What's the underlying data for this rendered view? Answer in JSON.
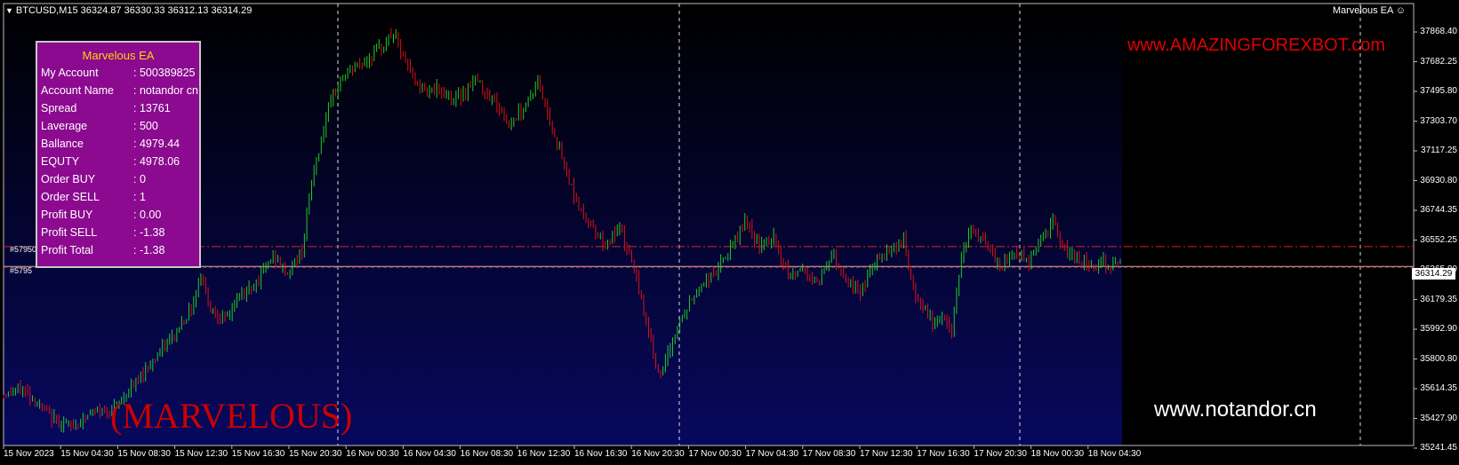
{
  "header": {
    "symbol_info": "BTCUSD,M15  36324.87 36330.33 36312.13 36314.29",
    "ea_label": "Marvelous EA ☺"
  },
  "overlay": {
    "url_top": "www.AMAZINGFOREXBOT.com",
    "url_bottom": "www.notandor.cn",
    "brand": "(MARVELOUS)",
    "order_tag_1": "#57950",
    "order_tag_2": "#5795"
  },
  "panel": {
    "title": "Marvelous EA",
    "rows": [
      {
        "label": "My Account",
        "value": ": 500389825"
      },
      {
        "label": "Account Name",
        "value": ": notandor cn"
      },
      {
        "label": "Spread",
        "value": ": 13761"
      },
      {
        "label": "Laverage",
        "value": ": 500"
      },
      {
        "label": "Ballance",
        "value": ": 4979.44"
      },
      {
        "label": "EQUTY",
        "value": ": 4978.06"
      },
      {
        "label": "Order BUY",
        "value": ": 0"
      },
      {
        "label": "Order SELL",
        "value": ": 1"
      },
      {
        "label": "Profit BUY",
        "value": ": 0.00"
      },
      {
        "label": "Profit SELL",
        "value": ": -1.38"
      },
      {
        "label": "Profit Total",
        "value": ": -1.38"
      }
    ]
  },
  "price_axis": [
    "37868.40",
    "37682.25",
    "37495.80",
    "37303.70",
    "37117.25",
    "36930.80",
    "36744.35",
    "36552.25",
    "36365.80",
    "36179.35",
    "35992.90",
    "35800.80",
    "35614.35",
    "35427.90",
    "35241.45"
  ],
  "current_price": "36314.29",
  "time_axis": [
    "15 Nov 2023",
    "15 Nov 04:30",
    "15 Nov 08:30",
    "15 Nov 12:30",
    "15 Nov 16:30",
    "15 Nov 20:30",
    "16 Nov 00:30",
    "16 Nov 04:30",
    "16 Nov 08:30",
    "16 Nov 12:30",
    "16 Nov 16:30",
    "16 Nov 20:30",
    "17 Nov 00:30",
    "17 Nov 04:30",
    "17 Nov 08:30",
    "17 Nov 12:30",
    "17 Nov 16:30",
    "17 Nov 20:30",
    "18 Nov 00:30",
    "18 Nov 04:30"
  ],
  "chart_data": {
    "type": "candlestick",
    "symbol": "BTCUSD",
    "timeframe": "M15",
    "ylim": [
      35180,
      37980
    ],
    "levels": {
      "order_line": 36440,
      "current": 36314.29
    },
    "path": [
      [
        0,
        35500
      ],
      [
        8,
        35540
      ],
      [
        20,
        35350
      ],
      [
        28,
        35300
      ],
      [
        36,
        35380
      ],
      [
        46,
        35420
      ],
      [
        54,
        35560
      ],
      [
        62,
        35720
      ],
      [
        70,
        35860
      ],
      [
        78,
        36050
      ],
      [
        82,
        36270
      ],
      [
        86,
        36050
      ],
      [
        92,
        35970
      ],
      [
        98,
        36120
      ],
      [
        106,
        36240
      ],
      [
        112,
        36380
      ],
      [
        118,
        36270
      ],
      [
        124,
        36420
      ],
      [
        128,
        36850
      ],
      [
        134,
        37250
      ],
      [
        140,
        37500
      ],
      [
        146,
        37580
      ],
      [
        152,
        37630
      ],
      [
        158,
        37720
      ],
      [
        162,
        37800
      ],
      [
        166,
        37640
      ],
      [
        172,
        37460
      ],
      [
        180,
        37430
      ],
      [
        188,
        37370
      ],
      [
        196,
        37500
      ],
      [
        204,
        37360
      ],
      [
        210,
        37220
      ],
      [
        216,
        37320
      ],
      [
        222,
        37480
      ],
      [
        228,
        37200
      ],
      [
        234,
        36900
      ],
      [
        240,
        36650
      ],
      [
        246,
        36550
      ],
      [
        250,
        36450
      ],
      [
        256,
        36550
      ],
      [
        262,
        36300
      ],
      [
        268,
        35900
      ],
      [
        273,
        35600
      ],
      [
        278,
        35850
      ],
      [
        284,
        36050
      ],
      [
        290,
        36200
      ],
      [
        296,
        36280
      ],
      [
        302,
        36420
      ],
      [
        308,
        36600
      ],
      [
        314,
        36430
      ],
      [
        320,
        36500
      ],
      [
        326,
        36250
      ],
      [
        332,
        36300
      ],
      [
        338,
        36200
      ],
      [
        344,
        36400
      ],
      [
        350,
        36230
      ],
      [
        356,
        36150
      ],
      [
        362,
        36350
      ],
      [
        368,
        36430
      ],
      [
        374,
        36480
      ],
      [
        378,
        36150
      ],
      [
        382,
        36050
      ],
      [
        386,
        35950
      ],
      [
        390,
        36000
      ],
      [
        394,
        35900
      ],
      [
        398,
        36400
      ],
      [
        402,
        36550
      ],
      [
        408,
        36450
      ],
      [
        414,
        36300
      ],
      [
        420,
        36400
      ],
      [
        426,
        36350
      ],
      [
        430,
        36470
      ],
      [
        436,
        36600
      ],
      [
        440,
        36420
      ],
      [
        444,
        36390
      ],
      [
        448,
        36350
      ],
      [
        452,
        36330
      ],
      [
        456,
        36340
      ],
      [
        460,
        36320
      ],
      [
        464,
        36330
      ]
    ]
  }
}
